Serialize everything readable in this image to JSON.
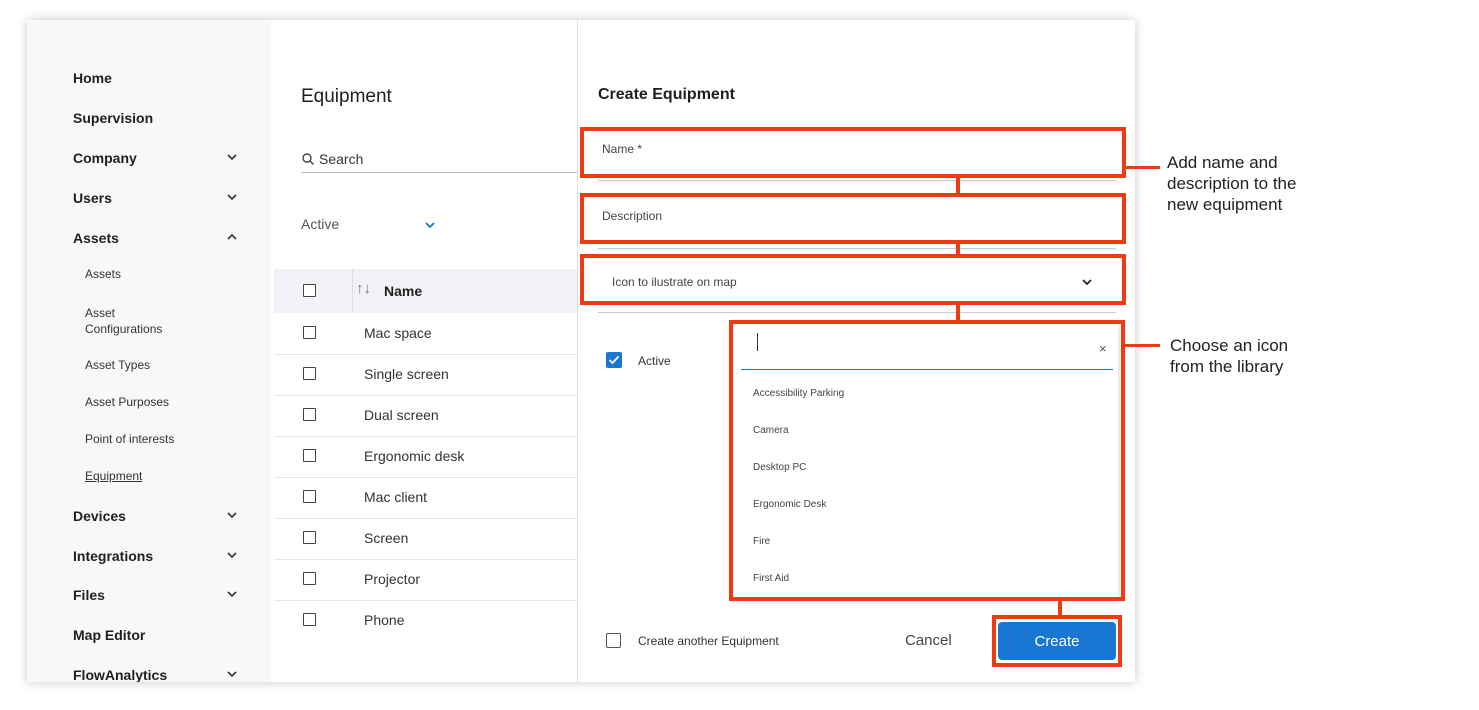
{
  "sidebar": {
    "items": [
      {
        "label": "Home",
        "chevron": "none"
      },
      {
        "label": "Supervision",
        "chevron": "none"
      },
      {
        "label": "Company",
        "chevron": "down"
      },
      {
        "label": "Users",
        "chevron": "down"
      },
      {
        "label": "Assets",
        "chevron": "up"
      },
      {
        "label": "Devices",
        "chevron": "down"
      },
      {
        "label": "Integrations",
        "chevron": "down"
      },
      {
        "label": "Files",
        "chevron": "down"
      },
      {
        "label": "Map Editor",
        "chevron": "none"
      },
      {
        "label": "FlowAnalytics",
        "chevron": "down"
      }
    ],
    "asset_subitems": [
      "Assets",
      "Asset\nConfigurations",
      "Asset Types",
      "Asset Purposes",
      "Point of interests",
      "Equipment"
    ],
    "active_subitem": "Equipment"
  },
  "list_panel": {
    "title": "Equipment",
    "search_placeholder": "Search",
    "filter_label": "Active",
    "column_header": "Name",
    "rows": [
      "Mac space",
      "Single screen",
      "Dual screen",
      "Ergonomic desk",
      "Mac client",
      "Screen",
      "Projector",
      "Phone"
    ]
  },
  "drawer": {
    "title": "Create Equipment",
    "name_label": "Name *",
    "description_label": "Description",
    "icon_label": "Icon to ilustrate on map",
    "active_label": "Active",
    "active_checked": true,
    "create_another_label": "Create another Equipment",
    "cancel_label": "Cancel",
    "create_label": "Create"
  },
  "icon_dropdown": {
    "search_value": "",
    "clear_symbol": "×",
    "options": [
      "Accessibility Parking",
      "Camera",
      "Desktop PC",
      "Ergonomic Desk",
      "Fire",
      "First Aid"
    ]
  },
  "annotations": {
    "note_fields": "Add name and\ndescription to the\nnew equipment",
    "note_icon": "Choose an icon\nfrom the library",
    "highlight_color": "#ee3b14"
  },
  "colors": {
    "accent": "#1976d2",
    "sidebar_bg": "#f7f8fa"
  }
}
